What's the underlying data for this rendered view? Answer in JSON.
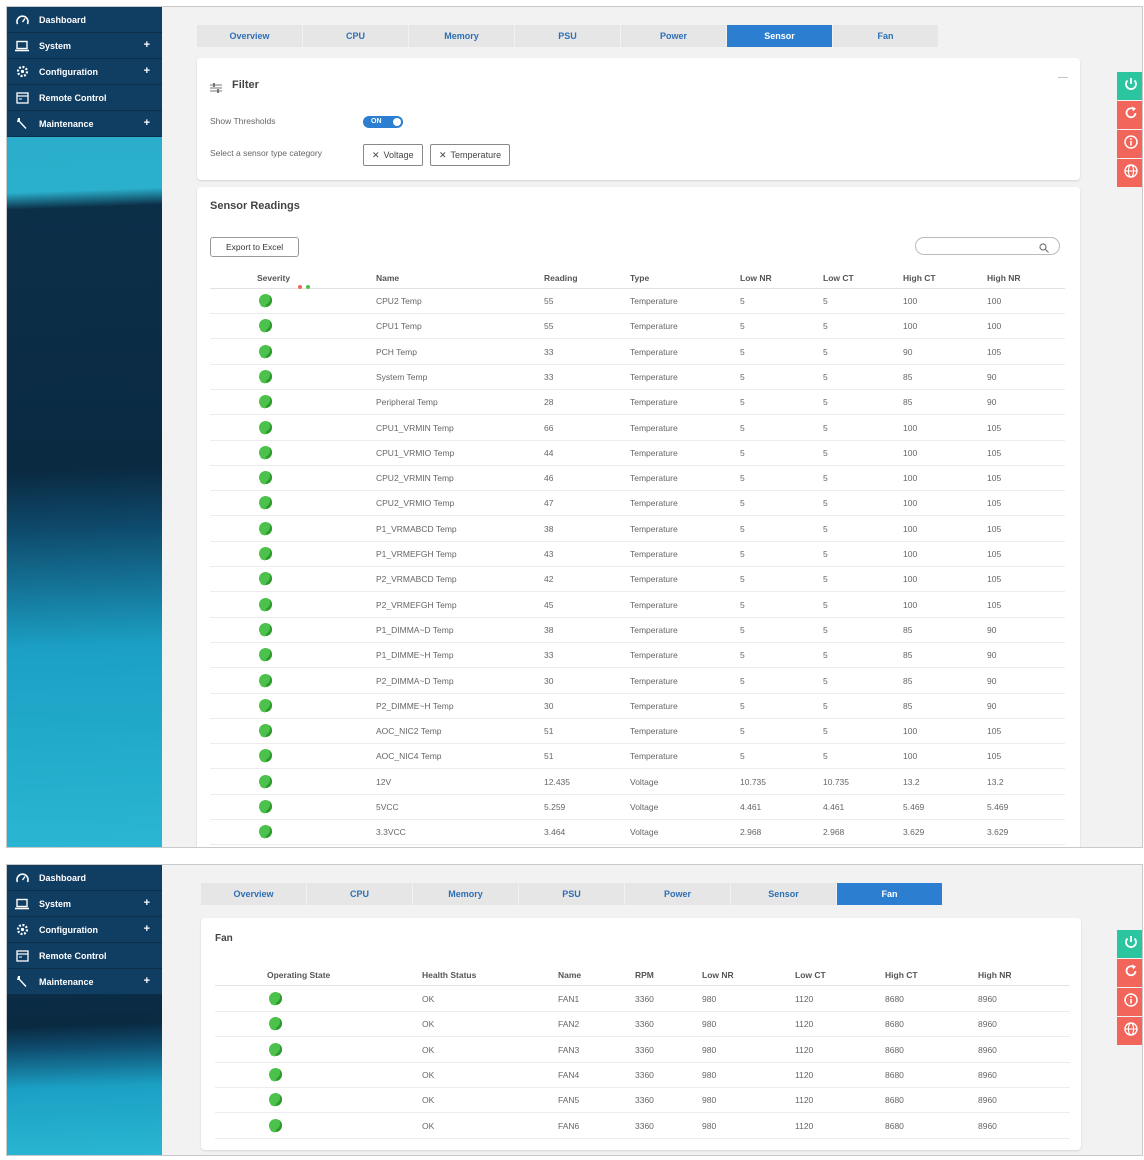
{
  "nav": {
    "items": [
      {
        "label": "Dashboard",
        "icon": "dashboard-icon",
        "expandable": false
      },
      {
        "label": "System",
        "icon": "laptop-icon",
        "expandable": true
      },
      {
        "label": "Configuration",
        "icon": "gear-icon",
        "expandable": true
      },
      {
        "label": "Remote Control",
        "icon": "console-icon",
        "expandable": false
      },
      {
        "label": "Maintenance",
        "icon": "wrench-icon",
        "expandable": true
      }
    ],
    "expand_symbol": "+"
  },
  "tabs": [
    "Overview",
    "CPU",
    "Memory",
    "PSU",
    "Power",
    "Sensor",
    "Fan"
  ],
  "sensor_view": {
    "active_tab": "Sensor",
    "filter": {
      "title": "Filter",
      "collapse_symbol": "—",
      "show_thresholds_label": "Show Thresholds",
      "show_thresholds_value": "ON",
      "category_label": "Select a sensor type category",
      "chips": [
        "Voltage",
        "Temperature"
      ]
    },
    "readings": {
      "title": "Sensor Readings",
      "export_label": "Export to Excel",
      "search_placeholder": "",
      "columns": [
        "Severity",
        "Name",
        "Reading",
        "Type",
        "Low NR",
        "Low CT",
        "High CT",
        "High NR"
      ],
      "rows": [
        [
          "CPU2 Temp",
          "55",
          "Temperature",
          "5",
          "5",
          "100",
          "100"
        ],
        [
          "CPU1 Temp",
          "55",
          "Temperature",
          "5",
          "5",
          "100",
          "100"
        ],
        [
          "PCH Temp",
          "33",
          "Temperature",
          "5",
          "5",
          "90",
          "105"
        ],
        [
          "System Temp",
          "33",
          "Temperature",
          "5",
          "5",
          "85",
          "90"
        ],
        [
          "Peripheral Temp",
          "28",
          "Temperature",
          "5",
          "5",
          "85",
          "90"
        ],
        [
          "CPU1_VRMIN Temp",
          "66",
          "Temperature",
          "5",
          "5",
          "100",
          "105"
        ],
        [
          "CPU1_VRMIO Temp",
          "44",
          "Temperature",
          "5",
          "5",
          "100",
          "105"
        ],
        [
          "CPU2_VRMIN Temp",
          "46",
          "Temperature",
          "5",
          "5",
          "100",
          "105"
        ],
        [
          "CPU2_VRMIO Temp",
          "47",
          "Temperature",
          "5",
          "5",
          "100",
          "105"
        ],
        [
          "P1_VRMABCD Temp",
          "38",
          "Temperature",
          "5",
          "5",
          "100",
          "105"
        ],
        [
          "P1_VRMEFGH Temp",
          "43",
          "Temperature",
          "5",
          "5",
          "100",
          "105"
        ],
        [
          "P2_VRMABCD Temp",
          "42",
          "Temperature",
          "5",
          "5",
          "100",
          "105"
        ],
        [
          "P2_VRMEFGH Temp",
          "45",
          "Temperature",
          "5",
          "5",
          "100",
          "105"
        ],
        [
          "P1_DIMMA~D Temp",
          "38",
          "Temperature",
          "5",
          "5",
          "85",
          "90"
        ],
        [
          "P1_DIMME~H Temp",
          "33",
          "Temperature",
          "5",
          "5",
          "85",
          "90"
        ],
        [
          "P2_DIMMA~D Temp",
          "30",
          "Temperature",
          "5",
          "5",
          "85",
          "90"
        ],
        [
          "P2_DIMME~H Temp",
          "30",
          "Temperature",
          "5",
          "5",
          "85",
          "90"
        ],
        [
          "AOC_NIC2 Temp",
          "51",
          "Temperature",
          "5",
          "5",
          "100",
          "105"
        ],
        [
          "AOC_NIC4 Temp",
          "51",
          "Temperature",
          "5",
          "5",
          "100",
          "105"
        ],
        [
          "12V",
          "12.435",
          "Voltage",
          "10.735",
          "10.735",
          "13.2",
          "13.2"
        ],
        [
          "5VCC",
          "5.259",
          "Voltage",
          "4.461",
          "4.461",
          "5.469",
          "5.469"
        ],
        [
          "3.3VCC",
          "3.464",
          "Voltage",
          "2.968",
          "2.968",
          "3.629",
          "3.629"
        ]
      ]
    }
  },
  "fan_view": {
    "active_tab": "Fan",
    "title": "Fan",
    "columns": [
      "Operating State",
      "Health Status",
      "Name",
      "RPM",
      "Low NR",
      "Low CT",
      "High CT",
      "High NR"
    ],
    "rows": [
      [
        "OK",
        "FAN1",
        "3360",
        "980",
        "1120",
        "8680",
        "8960"
      ],
      [
        "OK",
        "FAN2",
        "3360",
        "980",
        "1120",
        "8680",
        "8960"
      ],
      [
        "OK",
        "FAN3",
        "3360",
        "980",
        "1120",
        "8680",
        "8960"
      ],
      [
        "OK",
        "FAN4",
        "3360",
        "980",
        "1120",
        "8680",
        "8960"
      ],
      [
        "OK",
        "FAN5",
        "3360",
        "980",
        "1120",
        "8680",
        "8960"
      ],
      [
        "OK",
        "FAN6",
        "3360",
        "980",
        "1120",
        "8680",
        "8960"
      ]
    ]
  },
  "side_buttons": [
    {
      "icon": "power-icon",
      "color": "#2bc5a0"
    },
    {
      "icon": "refresh-icon",
      "color": "#f2655a"
    },
    {
      "icon": "info-icon",
      "color": "#f2655a"
    },
    {
      "icon": "globe-icon",
      "color": "#f2655a"
    }
  ],
  "colors": {
    "accent": "#2c7fd0",
    "status_ok": "#4cc24c",
    "sidebar": "#103d62"
  }
}
